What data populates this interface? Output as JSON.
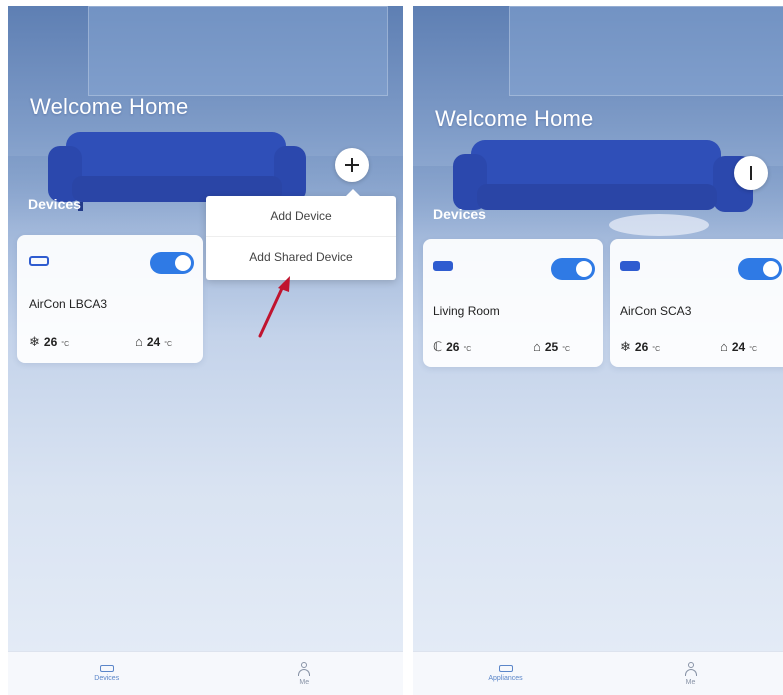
{
  "left": {
    "welcome": "Welcome Home",
    "devices_label": "Devices",
    "add_button_icon": "plus-icon",
    "menu": {
      "items": [
        "Add Device",
        "Add Shared Device"
      ]
    },
    "card": {
      "name": "AirCon LBCA3",
      "toggle_on": true,
      "readings": [
        {
          "icon": "fan-icon",
          "glyph": "❄",
          "value": "26",
          "unit": "°C"
        },
        {
          "icon": "home-temp-icon",
          "glyph": "⌂",
          "value": "24",
          "unit": "°C"
        }
      ]
    },
    "tabs": [
      {
        "label": "Devices",
        "icon": "device-icon",
        "active": true
      },
      {
        "label": "Me",
        "icon": "person-icon",
        "active": false
      }
    ]
  },
  "right": {
    "welcome": "Welcome Home",
    "devices_label": "Devices",
    "add_button_icon": "menu-bar-icon",
    "cards": [
      {
        "name": "Living Room",
        "toggle_on": true,
        "readings": [
          {
            "icon": "temp-icon",
            "glyph": "ℂ",
            "value": "26",
            "unit": "°C"
          },
          {
            "icon": "home-temp-icon",
            "glyph": "⌂",
            "value": "25",
            "unit": "°C"
          }
        ]
      },
      {
        "name": "AirCon SCA3",
        "toggle_on": true,
        "readings": [
          {
            "icon": "fan-icon",
            "glyph": "❄",
            "value": "26",
            "unit": "°C"
          },
          {
            "icon": "home-temp-icon",
            "glyph": "⌂",
            "value": "24",
            "unit": "°C"
          }
        ]
      }
    ],
    "tabs": [
      {
        "label": "Appliances",
        "icon": "device-icon",
        "active": true
      },
      {
        "label": "Me",
        "icon": "person-icon",
        "active": false
      }
    ]
  },
  "colors": {
    "accent": "#2f7ae5",
    "device_icon": "#2f5cd0",
    "sofa": "#2f4fb8",
    "annotation_arrow": "#c0142f"
  }
}
